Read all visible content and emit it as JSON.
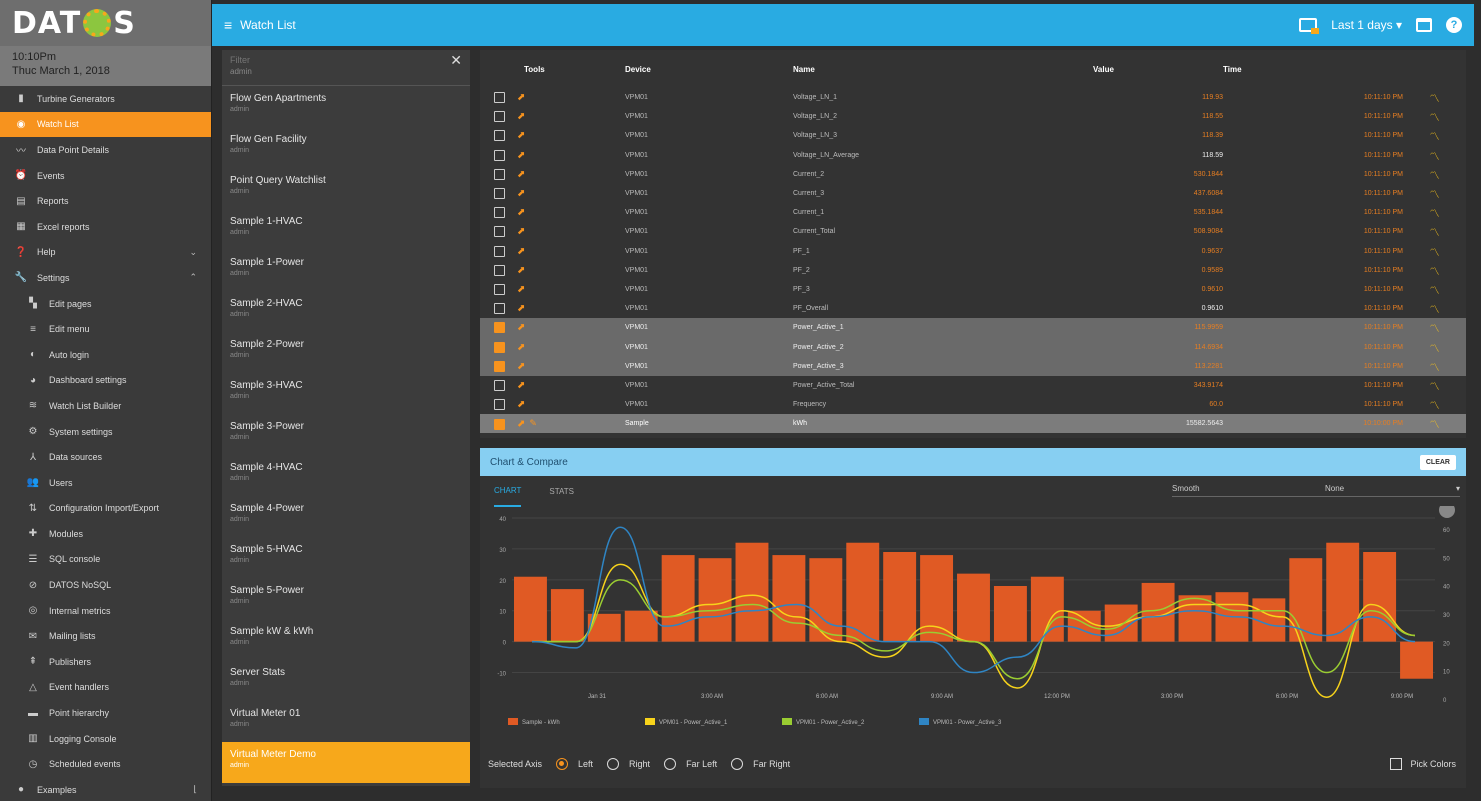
{
  "brand": {
    "logo_text": "DATOS"
  },
  "clock": {
    "time": "10:10Pm",
    "date": "Thuc March 1, 2018"
  },
  "nav": [
    {
      "label": "Turbine Generators",
      "icon": "bar-chart-icon",
      "glyph": "▮",
      "sub": false
    },
    {
      "label": "Watch List",
      "icon": "eye-icon",
      "glyph": "◉",
      "sub": false,
      "active": true
    },
    {
      "label": "Data Point Details",
      "icon": "trend-icon",
      "glyph": "〰",
      "sub": false
    },
    {
      "label": "Events",
      "icon": "alarm-icon",
      "glyph": "⏰",
      "sub": false
    },
    {
      "label": "Reports",
      "icon": "report-icon",
      "glyph": "▤",
      "sub": false
    },
    {
      "label": "Excel reports",
      "icon": "grid-icon",
      "glyph": "▦",
      "sub": false
    },
    {
      "label": "Help",
      "icon": "help-icon",
      "glyph": "❓",
      "sub": false,
      "caret": "⌄"
    },
    {
      "label": "Settings",
      "icon": "wrench-icon",
      "glyph": "🔧",
      "sub": false,
      "caret": "⌃"
    },
    {
      "label": "Edit pages",
      "icon": "dashboard-icon",
      "glyph": "▚",
      "sub": true
    },
    {
      "label": "Edit menu",
      "icon": "menu-icon",
      "glyph": "≡",
      "sub": true
    },
    {
      "label": "Auto login",
      "icon": "login-icon",
      "glyph": "◐",
      "sub": true
    },
    {
      "label": "Dashboard settings",
      "icon": "palette-icon",
      "glyph": "◕",
      "sub": true
    },
    {
      "label": "Watch List Builder",
      "icon": "builder-icon",
      "glyph": "≋",
      "sub": true
    },
    {
      "label": "System settings",
      "icon": "gear-icon",
      "glyph": "⚙",
      "sub": true
    },
    {
      "label": "Data sources",
      "icon": "datasource-icon",
      "glyph": "⅄",
      "sub": true
    },
    {
      "label": "Users",
      "icon": "users-icon",
      "glyph": "👥",
      "sub": true
    },
    {
      "label": "Configuration Import/Export",
      "icon": "import-export-icon",
      "glyph": "⇅",
      "sub": true
    },
    {
      "label": "Modules",
      "icon": "puzzle-icon",
      "glyph": "✚",
      "sub": true
    },
    {
      "label": "SQL console",
      "icon": "console-icon",
      "glyph": "☰",
      "sub": true
    },
    {
      "label": "DATOS NoSQL",
      "icon": "nosql-icon",
      "glyph": "⊘",
      "sub": true
    },
    {
      "label": "Internal metrics",
      "icon": "metrics-icon",
      "glyph": "◎",
      "sub": true
    },
    {
      "label": "Mailing lists",
      "icon": "mail-icon",
      "glyph": "✉",
      "sub": true
    },
    {
      "label": "Publishers",
      "icon": "publish-icon",
      "glyph": "⇞",
      "sub": true
    },
    {
      "label": "Event handlers",
      "icon": "warning-icon",
      "glyph": "△",
      "sub": true
    },
    {
      "label": "Point hierarchy",
      "icon": "folder-icon",
      "glyph": "▬",
      "sub": true
    },
    {
      "label": "Logging Console",
      "icon": "log-icon",
      "glyph": "▥",
      "sub": true
    },
    {
      "label": "Scheduled events",
      "icon": "schedule-icon",
      "glyph": "◷",
      "sub": true
    },
    {
      "label": "Examples",
      "icon": "examples-icon",
      "glyph": "●",
      "sub": false,
      "caret": "⌊"
    }
  ],
  "topbar": {
    "title": "Watch List",
    "range_label": "Last 1 days",
    "range_caret": "▾",
    "help_glyph": "?"
  },
  "filter": {
    "placeholder": "Filter",
    "owner": "admin",
    "close_glyph": "✕"
  },
  "watchlists": [
    {
      "name": "Flow Gen Apartments",
      "owner": "admin"
    },
    {
      "name": "Flow Gen Facility",
      "owner": "admin"
    },
    {
      "name": "Point Query Watchlist",
      "owner": "admin"
    },
    {
      "name": "Sample 1-HVAC",
      "owner": "admin"
    },
    {
      "name": "Sample 1-Power",
      "owner": "admin"
    },
    {
      "name": "Sample 2-HVAC",
      "owner": "admin"
    },
    {
      "name": "Sample 2-Power",
      "owner": "admin"
    },
    {
      "name": "Sample 3-HVAC",
      "owner": "admin"
    },
    {
      "name": "Sample 3-Power",
      "owner": "admin"
    },
    {
      "name": "Sample 4-HVAC",
      "owner": "admin"
    },
    {
      "name": "Sample 4-Power",
      "owner": "admin"
    },
    {
      "name": "Sample 5-HVAC",
      "owner": "admin"
    },
    {
      "name": "Sample 5-Power",
      "owner": "admin"
    },
    {
      "name": "Sample kW & kWh",
      "owner": "admin"
    },
    {
      "name": "Server Stats",
      "owner": "admin"
    },
    {
      "name": "Virtual Meter 01",
      "owner": "admin"
    },
    {
      "name": "Virtual Meter Demo",
      "owner": "admin",
      "active": true
    }
  ],
  "table": {
    "headers": {
      "tools": "Tools",
      "device": "Device",
      "name": "Name",
      "value": "Value",
      "time": "Time"
    },
    "rows": [
      {
        "device": "VPM01",
        "name": "Voltage_LN_1",
        "value": "119.93",
        "time": "10:11:10 PM",
        "checked": false,
        "orange": true
      },
      {
        "device": "VPM01",
        "name": "Voltage_LN_2",
        "value": "118.55",
        "time": "10:11:10 PM",
        "checked": false,
        "orange": true
      },
      {
        "device": "VPM01",
        "name": "Voltage_LN_3",
        "value": "118.39",
        "time": "10:11:10 PM",
        "checked": false,
        "orange": true
      },
      {
        "device": "VPM01",
        "name": "Voltage_LN_Average",
        "value": "118.59",
        "time": "10:11:10 PM",
        "checked": false,
        "orange": false
      },
      {
        "device": "VPM01",
        "name": "Current_2",
        "value": "530.1844",
        "time": "10:11:10 PM",
        "checked": false,
        "orange": true
      },
      {
        "device": "VPM01",
        "name": "Current_3",
        "value": "437.6084",
        "time": "10:11:10 PM",
        "checked": false,
        "orange": true
      },
      {
        "device": "VPM01",
        "name": "Current_1",
        "value": "535.1844",
        "time": "10:11:10 PM",
        "checked": false,
        "orange": true
      },
      {
        "device": "VPM01",
        "name": "Current_Total",
        "value": "508.9084",
        "time": "10:11:10 PM",
        "checked": false,
        "orange": true
      },
      {
        "device": "VPM01",
        "name": "PF_1",
        "value": "0.9637",
        "time": "10:11:10 PM",
        "checked": false,
        "orange": true
      },
      {
        "device": "VPM01",
        "name": "PF_2",
        "value": "0.9589",
        "time": "10:11:10 PM",
        "checked": false,
        "orange": true
      },
      {
        "device": "VPM01",
        "name": "PF_3",
        "value": "0.9610",
        "time": "10:11:10 PM",
        "checked": false,
        "orange": true
      },
      {
        "device": "VPM01",
        "name": "PF_Overall",
        "value": "0.9610",
        "time": "10:11:10 PM",
        "checked": false,
        "orange": false
      },
      {
        "device": "VPM01",
        "name": "Power_Active_1",
        "value": "115.9959",
        "time": "10:11:10 PM",
        "checked": true,
        "orange": true
      },
      {
        "device": "VPM01",
        "name": "Power_Active_2",
        "value": "114.6934",
        "time": "10:11:10 PM",
        "checked": true,
        "orange": true
      },
      {
        "device": "VPM01",
        "name": "Power_Active_3",
        "value": "113.2281",
        "time": "10:11:10 PM",
        "checked": true,
        "orange": true
      },
      {
        "device": "VPM01",
        "name": "Power_Active_Total",
        "value": "343.9174",
        "time": "10:11:10 PM",
        "checked": false,
        "orange": true
      },
      {
        "device": "VPM01",
        "name": "Frequency",
        "value": "60.0",
        "time": "10:11:10 PM",
        "checked": false,
        "orange": true
      },
      {
        "device": "Sample",
        "name": "kWh",
        "value": "15582.5643",
        "time": "10:10:00 PM",
        "checked": true,
        "orange": false,
        "highlight": true,
        "pencil": true
      }
    ]
  },
  "chart_panel": {
    "title": "Chart & Compare",
    "clear_label": "CLEAR",
    "tabs": [
      "CHART",
      "STATS"
    ],
    "smooth_label": "Smooth",
    "none_label": "None",
    "dropdown_glyph": "▾",
    "axis_label": "Selected Axis",
    "axis_options": [
      "Left",
      "Right",
      "Far Left",
      "Far Right"
    ],
    "pick_colors_label": "Pick Colors"
  },
  "colors": {
    "accent": "#f7931e",
    "topbar": "#29abe2",
    "bar": "#e05a24"
  },
  "chart_data": {
    "type": "bar",
    "x_tick_labels": [
      "Jan 31",
      "3:00 AM",
      "6:00 AM",
      "9:00 AM",
      "12:00 PM",
      "3:00 PM",
      "6:00 PM",
      "9:00 PM"
    ],
    "ylim": [
      -15,
      40
    ],
    "y_ticks": [
      40,
      30,
      20,
      10,
      0,
      -10
    ],
    "y2_ticks": [
      60,
      50,
      40,
      30,
      20,
      10,
      0
    ],
    "series": [
      {
        "name": "Sample - kWh",
        "color": "#e05a24",
        "kind": "bar",
        "values": [
          21,
          17,
          9,
          10,
          28,
          27,
          32,
          28,
          27,
          32,
          29,
          28,
          22,
          18,
          21,
          10,
          12,
          19,
          15,
          16,
          14,
          27,
          32,
          29,
          -12
        ]
      },
      {
        "name": "VPM01 - Power_Active_1",
        "color": "#f7d31b",
        "kind": "line",
        "values": [
          0,
          0,
          25,
          8,
          12,
          15,
          8,
          0,
          -5,
          5,
          0,
          -15,
          10,
          5,
          8,
          12,
          12,
          8,
          -18,
          12,
          2
        ]
      },
      {
        "name": "VPM01 - Power_Active_2",
        "color": "#9acd32",
        "kind": "line",
        "values": [
          0,
          0,
          20,
          8,
          10,
          12,
          6,
          2,
          -3,
          3,
          0,
          -12,
          8,
          4,
          10,
          14,
          10,
          10,
          -10,
          10,
          2
        ]
      },
      {
        "name": "VPM01 - Power_Active_3",
        "color": "#2f85c4",
        "kind": "line",
        "values": [
          0,
          -2,
          37,
          5,
          8,
          10,
          12,
          5,
          0,
          0,
          -10,
          -5,
          5,
          2,
          8,
          10,
          8,
          5,
          2,
          8,
          0
        ]
      }
    ]
  }
}
